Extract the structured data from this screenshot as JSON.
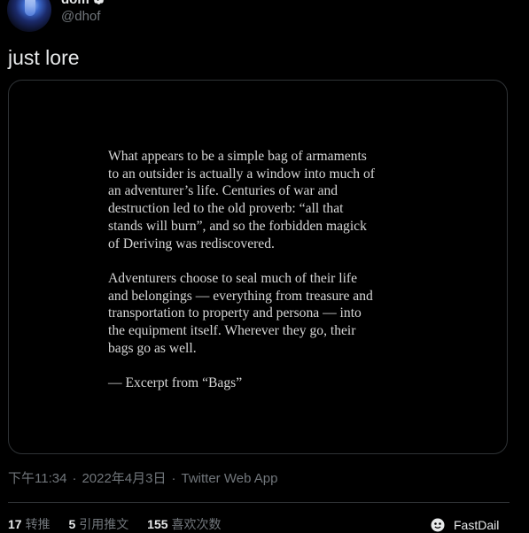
{
  "header": {
    "display_name": "dom",
    "handle": "@dhof",
    "more_label": "···"
  },
  "tweet": {
    "text": "just lore"
  },
  "media": {
    "paragraphs": [
      "What appears to be a simple bag of armaments\nto an outsider is actually a window into much of\nan adventurer’s life. Centuries of war and\ndestruction led to the old proverb: “all that\nstands will burn”, and so the forbidden magick\nof Deriving was rediscovered.",
      "Adventurers choose to seal much of their life\nand belongings — everything from treasure and\ntransportation to property and persona — into\nthe equipment itself. Wherever they go, their\nbags go as well.",
      "— Excerpt from “Bags”"
    ]
  },
  "meta": {
    "time": "下午11:34",
    "date": "2022年4月3日",
    "source": "Twitter Web App",
    "separator": "·"
  },
  "stats": {
    "retweets": {
      "count": "17",
      "label": "转推"
    },
    "quotes": {
      "count": "5",
      "label": "引用推文"
    },
    "likes": {
      "count": "155",
      "label": "喜欢次数"
    }
  },
  "extension": {
    "label": "FastDail"
  },
  "colors": {
    "background": "#000000",
    "text_primary": "#e7e9ea",
    "text_secondary": "#71767b",
    "border": "#2f3336",
    "verified_badge": "#e7e9ea"
  },
  "icons": {
    "verified": "verified-badge-icon",
    "more": "more-icon",
    "extension": "face-icon"
  }
}
